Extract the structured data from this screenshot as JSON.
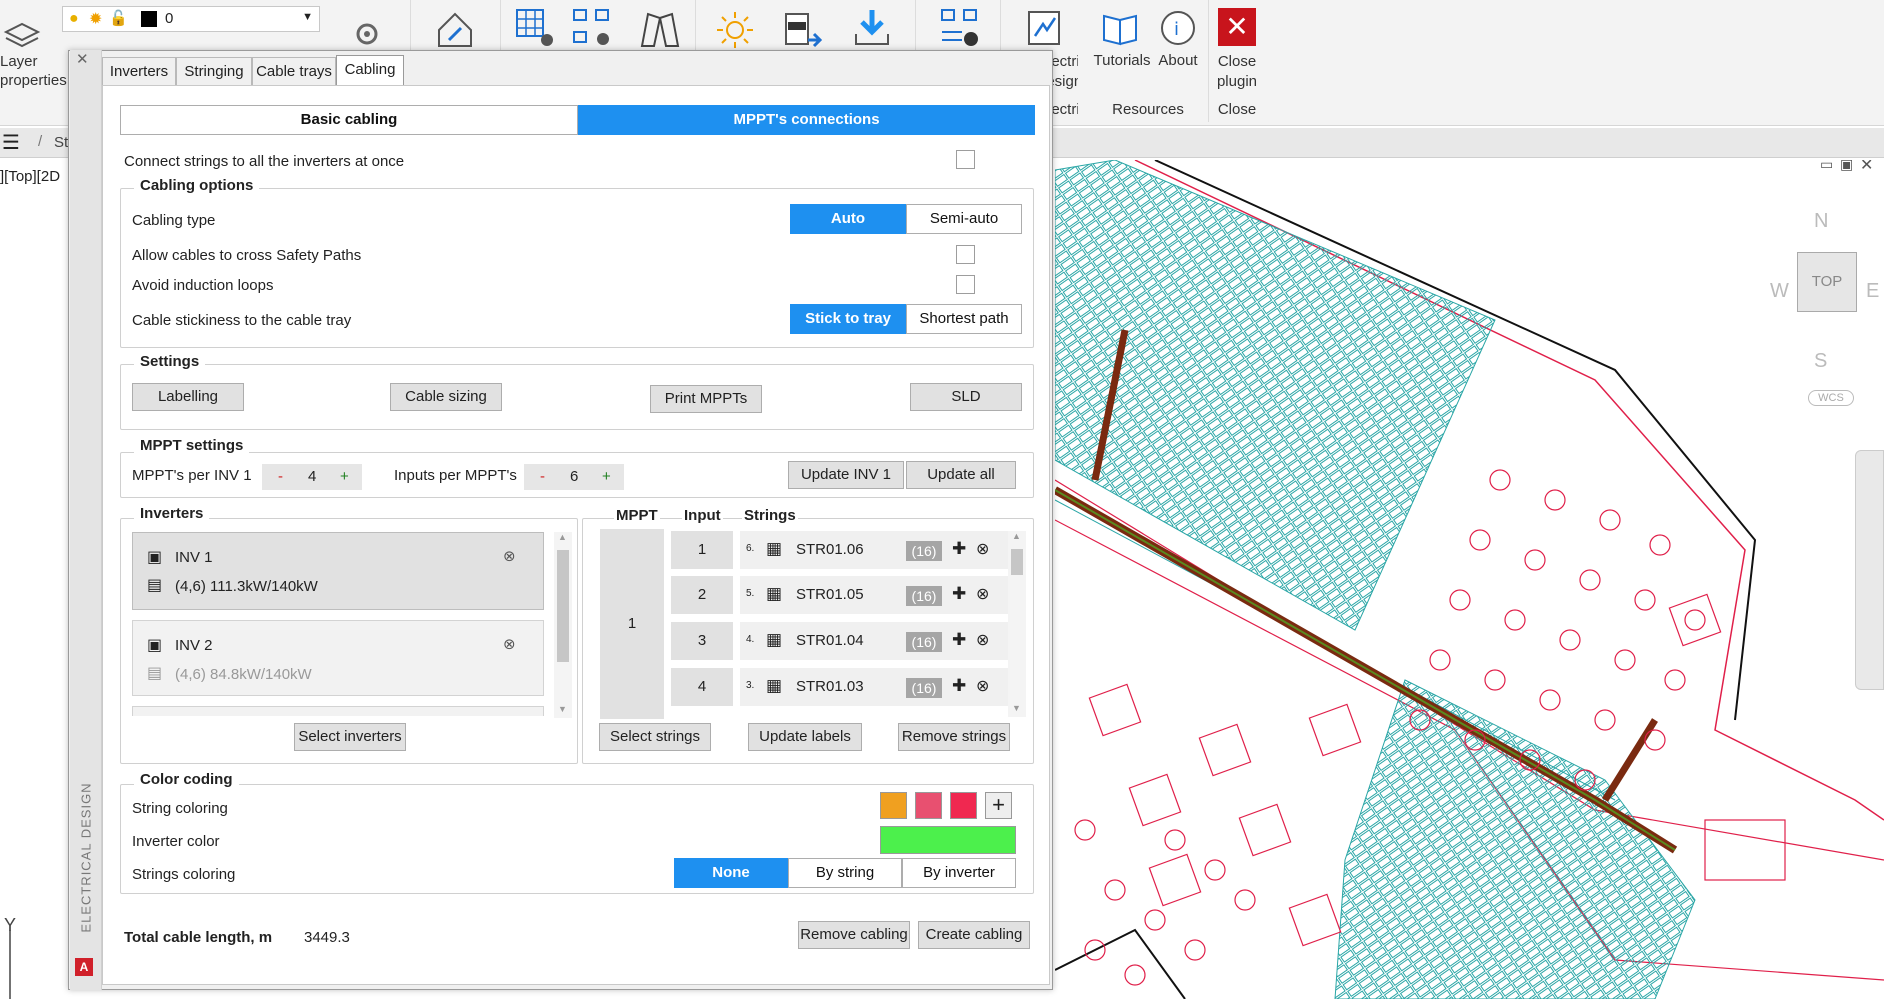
{
  "ribbon": {
    "layer_properties_label": "Layer\nproperties",
    "layer_value": "0",
    "electrical_design_label": "Electrical\ndesign",
    "electrical_group": "Electrical",
    "tutorials_label": "Tutorials",
    "about_label": "About",
    "resources_group": "Resources",
    "close_plugin_label": "Close\nplugin",
    "close_group": "Close"
  },
  "subbar": {
    "crumb": "St"
  },
  "viewport_label": "][Top][2D",
  "viewcube": {
    "n": "N",
    "s": "S",
    "e": "E",
    "w": "W",
    "top": "TOP",
    "wcs": "WCS"
  },
  "panel": {
    "vertical_title": "ELECTRICAL DESIGN",
    "tabs": [
      "Inverters",
      "Stringing",
      "Cable trays",
      "Cabling"
    ],
    "active_tab": "Cabling",
    "mode": {
      "basic": "Basic cabling",
      "mppt": "MPPT's connections"
    },
    "connect_all_label": "Connect strings to all the inverters at once",
    "cabling_options": {
      "title": "Cabling options",
      "cabling_type_label": "Cabling type",
      "auto": "Auto",
      "semi_auto": "Semi-auto",
      "cross_safety_label": "Allow cables to cross Safety Paths",
      "avoid_loops_label": "Avoid induction loops",
      "stickiness_label": "Cable stickiness to the cable tray",
      "stick": "Stick to tray",
      "shortest": "Shortest path"
    },
    "settings": {
      "title": "Settings",
      "labelling": "Labelling",
      "cable_sizing": "Cable sizing",
      "print_mppts": "Print MPPTs",
      "sld": "SLD"
    },
    "mppt_settings": {
      "title": "MPPT settings",
      "mppts_label": "MPPT's per INV 1",
      "mppts_value": "4",
      "inputs_label": "Inputs per MPPT's",
      "inputs_value": "6",
      "minus": "-",
      "plus": "+",
      "update_inv": "Update INV 1",
      "update_all": "Update all"
    },
    "inverters": {
      "title": "Inverters",
      "items": [
        {
          "name": "INV 1",
          "detail": "(4,6)  111.3kW/140kW"
        },
        {
          "name": "INV 2",
          "detail": "(4,6)  84.8kW/140kW"
        }
      ],
      "select_button": "Select inverters"
    },
    "mppt_table": {
      "headers": {
        "mppt": "MPPT",
        "input": "Input",
        "strings": "Strings"
      },
      "mppt_value": "1",
      "rows": [
        {
          "input": "1",
          "index": "6.",
          "string": "STR01.06",
          "count": "(16)"
        },
        {
          "input": "2",
          "index": "5.",
          "string": "STR01.05",
          "count": "(16)"
        },
        {
          "input": "3",
          "index": "4.",
          "string": "STR01.04",
          "count": "(16)"
        },
        {
          "input": "4",
          "index": "3.",
          "string": "STR01.03",
          "count": "(16)"
        }
      ],
      "select_strings": "Select strings",
      "update_labels": "Update labels",
      "remove_strings": "Remove strings"
    },
    "color_coding": {
      "title": "Color coding",
      "string_coloring_label": "String coloring",
      "swatches": [
        "#f0a020",
        "#e85070",
        "#f02850"
      ],
      "add": "+",
      "inverter_color_label": "Inverter color",
      "inverter_color": "#4cf04c",
      "strings_coloring_label": "Strings coloring",
      "none": "None",
      "by_string": "By string",
      "by_inverter": "By inverter"
    },
    "total_label": "Total cable length, m",
    "total_value": "3449.3",
    "remove_cabling": "Remove cabling",
    "create_cabling": "Create cabling"
  },
  "colors": {
    "accent": "#1e90f0",
    "panel_cyan": "#2aa6a6",
    "boundary_red": "#e0204a",
    "tray_brown": "#7a2a10"
  }
}
